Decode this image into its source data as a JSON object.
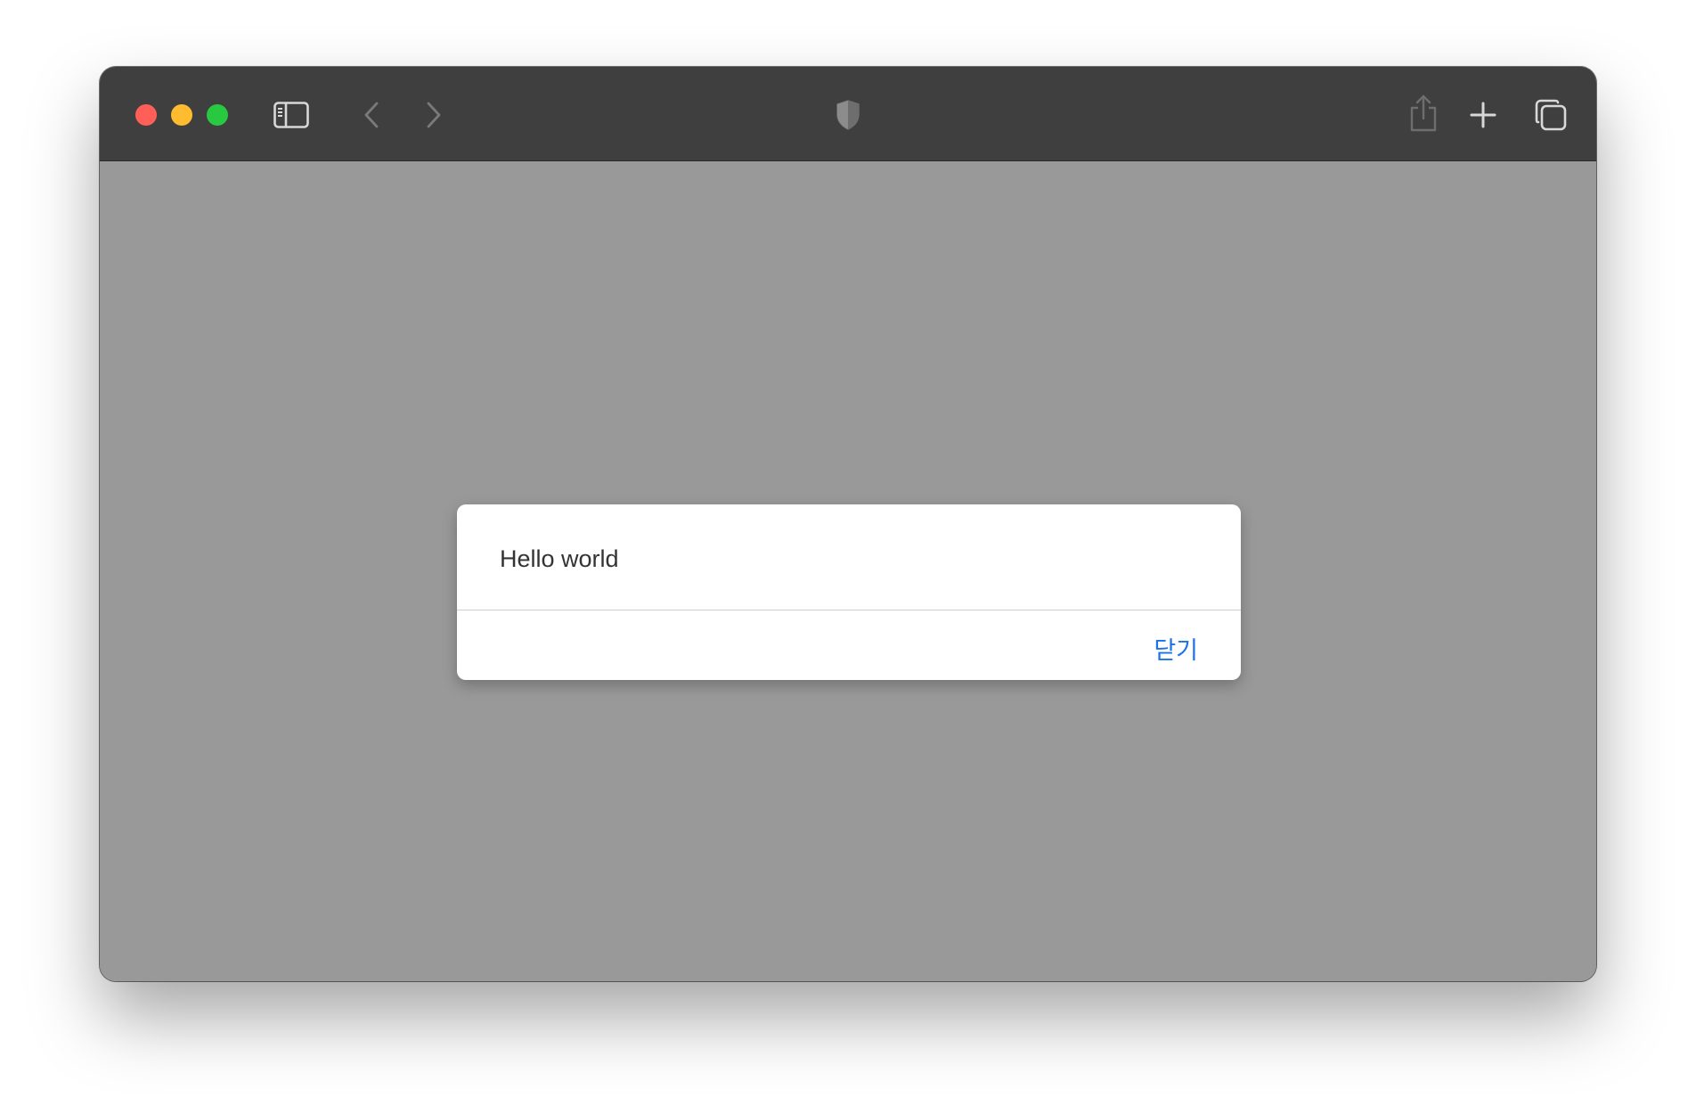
{
  "browser": {
    "toolbar_color": "#3f3f3f",
    "traffic_lights": {
      "close_color": "#ff5f57",
      "minimize_color": "#febc2e",
      "maximize_color": "#28c840"
    },
    "icons": {
      "sidebar": "sidebar-icon",
      "back": "chevron-left-icon",
      "forward": "chevron-right-icon",
      "privacy": "shield-icon",
      "share": "share-icon",
      "new_tab": "plus-icon",
      "tab_overview": "tabs-overview-icon"
    }
  },
  "page": {
    "background_color": "#999999"
  },
  "dialog": {
    "message": "Hello world",
    "close_label": "닫기",
    "button_color": "#1a73e8"
  }
}
